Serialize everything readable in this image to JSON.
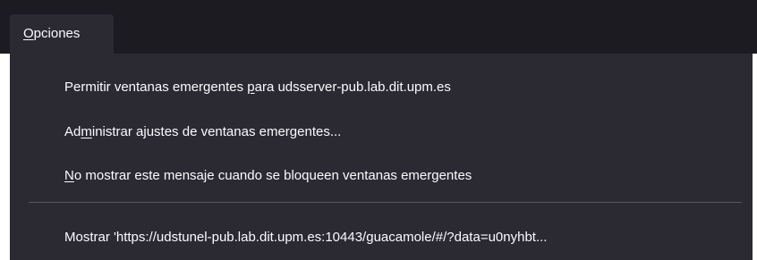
{
  "options_button": {
    "label_pre": "",
    "label_key": "O",
    "label_post": "pciones"
  },
  "menu": {
    "items": [
      {
        "label_pre": "Permitir ventanas emergentes ",
        "label_key": "p",
        "label_post": "ara udsserver-pub.lab.dit.upm.es"
      },
      {
        "label_pre": "Ad",
        "label_key": "m",
        "label_post": "inistrar ajustes de ventanas emergentes..."
      },
      {
        "label_pre": "",
        "label_key": "N",
        "label_post": "o mostrar este mensaje cuando se bloqueen ventanas emergentes"
      },
      {
        "label_pre": "Mostrar 'https://udstunel-pub.lab.dit.upm.es:10443/guacamole/#/?data=u0nyhbt...",
        "label_key": "",
        "label_post": ""
      }
    ]
  }
}
